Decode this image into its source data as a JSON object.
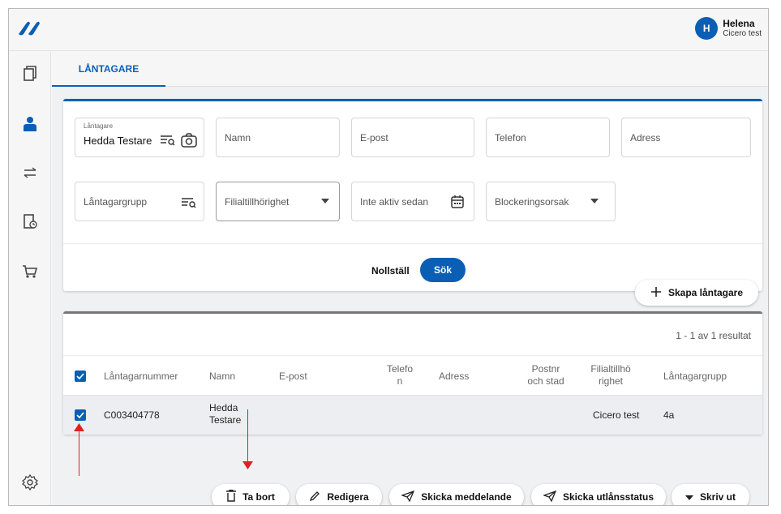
{
  "user": {
    "initial": "H",
    "name": "Helena",
    "org": "Cicero test"
  },
  "tabs": [
    {
      "label": "LÅNTAGARE"
    }
  ],
  "search": {
    "borrower": {
      "label": "Låntagare",
      "value": "Hedda Testare"
    },
    "name_placeholder": "Namn",
    "email_placeholder": "E-post",
    "phone_placeholder": "Telefon",
    "address_placeholder": "Adress",
    "group_placeholder": "Låntagargrupp",
    "branch_placeholder": "Filialtillhörighet",
    "inactive_placeholder": "Inte aktiv sedan",
    "block_placeholder": "Blockeringsorsak",
    "reset_label": "Nollställ",
    "search_label": "Sök"
  },
  "create_label": "Skapa låntagare",
  "results": {
    "count_text": "1 - 1 av 1 resultat",
    "columns": {
      "number": "Låntagarnummer",
      "name": "Namn",
      "email": "E-post",
      "phone_1": "Telefo",
      "phone_2": "n",
      "address": "Adress",
      "zip_1": "Postnr",
      "zip_2": "och stad",
      "branch_1": "Filialtillhö",
      "branch_2": "righet",
      "group": "Låntagargrupp"
    },
    "rows": [
      {
        "number": "C003404778",
        "name_1": "Hedda",
        "name_2": "Testare",
        "branch": "Cicero test",
        "group": "4a"
      }
    ]
  },
  "actions": {
    "delete": "Ta bort",
    "edit": "Redigera",
    "send_message": "Skicka meddelande",
    "send_status": "Skicka utlånsstatus",
    "print": "Skriv ut"
  },
  "colors": {
    "accent": "#0a5fb4",
    "annotation": "#e02020"
  },
  "icons": [
    "logo-icon",
    "books-icon",
    "borrower-icon",
    "transfer-icon",
    "history-icon",
    "cart-icon",
    "settings-icon",
    "search-list-icon",
    "camera-icon",
    "dropdown-icon",
    "calendar-icon",
    "plus-icon",
    "trash-icon",
    "pencil-icon",
    "send-icon",
    "chevron-down-icon",
    "checkbox-icon"
  ]
}
